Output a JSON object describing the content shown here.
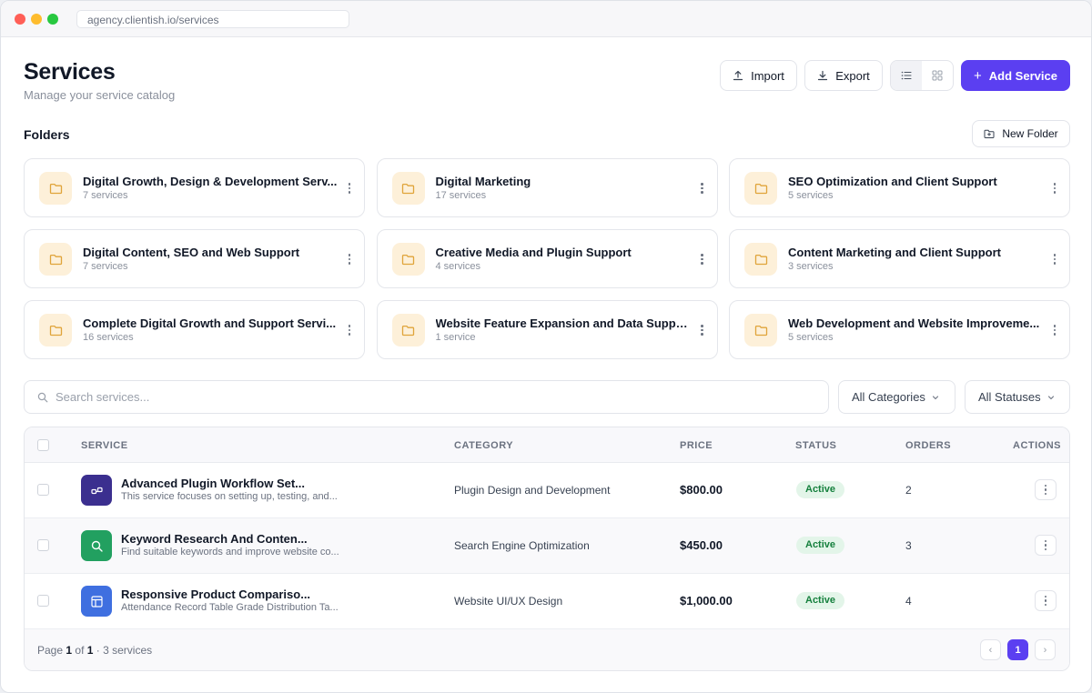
{
  "browser": {
    "url": "agency.clientish.io/services"
  },
  "header": {
    "title": "Services",
    "subtitle": "Manage your service catalog",
    "import_label": "Import",
    "export_label": "Export",
    "add_label": "Add Service"
  },
  "folders": {
    "title": "Folders",
    "new_folder_label": "New Folder",
    "items": [
      {
        "name": "Digital Growth, Design & Development Serv...",
        "count": "7 services"
      },
      {
        "name": "Digital Marketing",
        "count": "17 services"
      },
      {
        "name": "SEO Optimization and Client Support",
        "count": "5 services"
      },
      {
        "name": "Digital Content, SEO and Web Support",
        "count": "7 services"
      },
      {
        "name": "Creative Media and Plugin Support",
        "count": "4 services"
      },
      {
        "name": "Content Marketing and Client Support",
        "count": "3 services"
      },
      {
        "name": "Complete Digital Growth and Support Servi...",
        "count": "16 services"
      },
      {
        "name": "Website Feature Expansion and Data Support",
        "count": "1 service"
      },
      {
        "name": "Web Development and Website Improveme...",
        "count": "5 services"
      }
    ]
  },
  "filters": {
    "search_placeholder": "Search services...",
    "category": "All Categories",
    "status": "All Statuses"
  },
  "table": {
    "columns": {
      "service": "SERVICE",
      "category": "CATEGORY",
      "price": "PRICE",
      "status": "STATUS",
      "orders": "ORDERS",
      "actions": "ACTIONS"
    },
    "rows": [
      {
        "name": "Advanced Plugin Workflow Set...",
        "description": "This service focuses on setting up, testing, and...",
        "category": "Plugin Design and Development",
        "price": "$800.00",
        "status": "Active",
        "orders": "2",
        "icon": "plugin-icon",
        "color": "#3b2f8f"
      },
      {
        "name": "Keyword Research And Conten...",
        "description": "Find suitable keywords and improve website co...",
        "category": "Search Engine Optimization",
        "price": "$450.00",
        "status": "Active",
        "orders": "3",
        "icon": "search-icon",
        "color": "#22a060"
      },
      {
        "name": "Responsive Product Compariso...",
        "description": "Attendance Record Table Grade Distribution Ta...",
        "category": "Website UI/UX Design",
        "price": "$1,000.00",
        "status": "Active",
        "orders": "4",
        "icon": "layout-icon",
        "color": "#3f6fe0"
      }
    ]
  },
  "pagination": {
    "page_word": "Page",
    "page": "1",
    "of_word": "of",
    "total_pages": "1",
    "summary": "· 3 services",
    "prev": "‹",
    "next": "›",
    "current": "1"
  },
  "colors": {
    "accent": "#5b3ff1",
    "status_active_bg": "#e3f5e9",
    "status_active_text": "#15803d",
    "folder_icon_bg": "#fdf0d9"
  }
}
